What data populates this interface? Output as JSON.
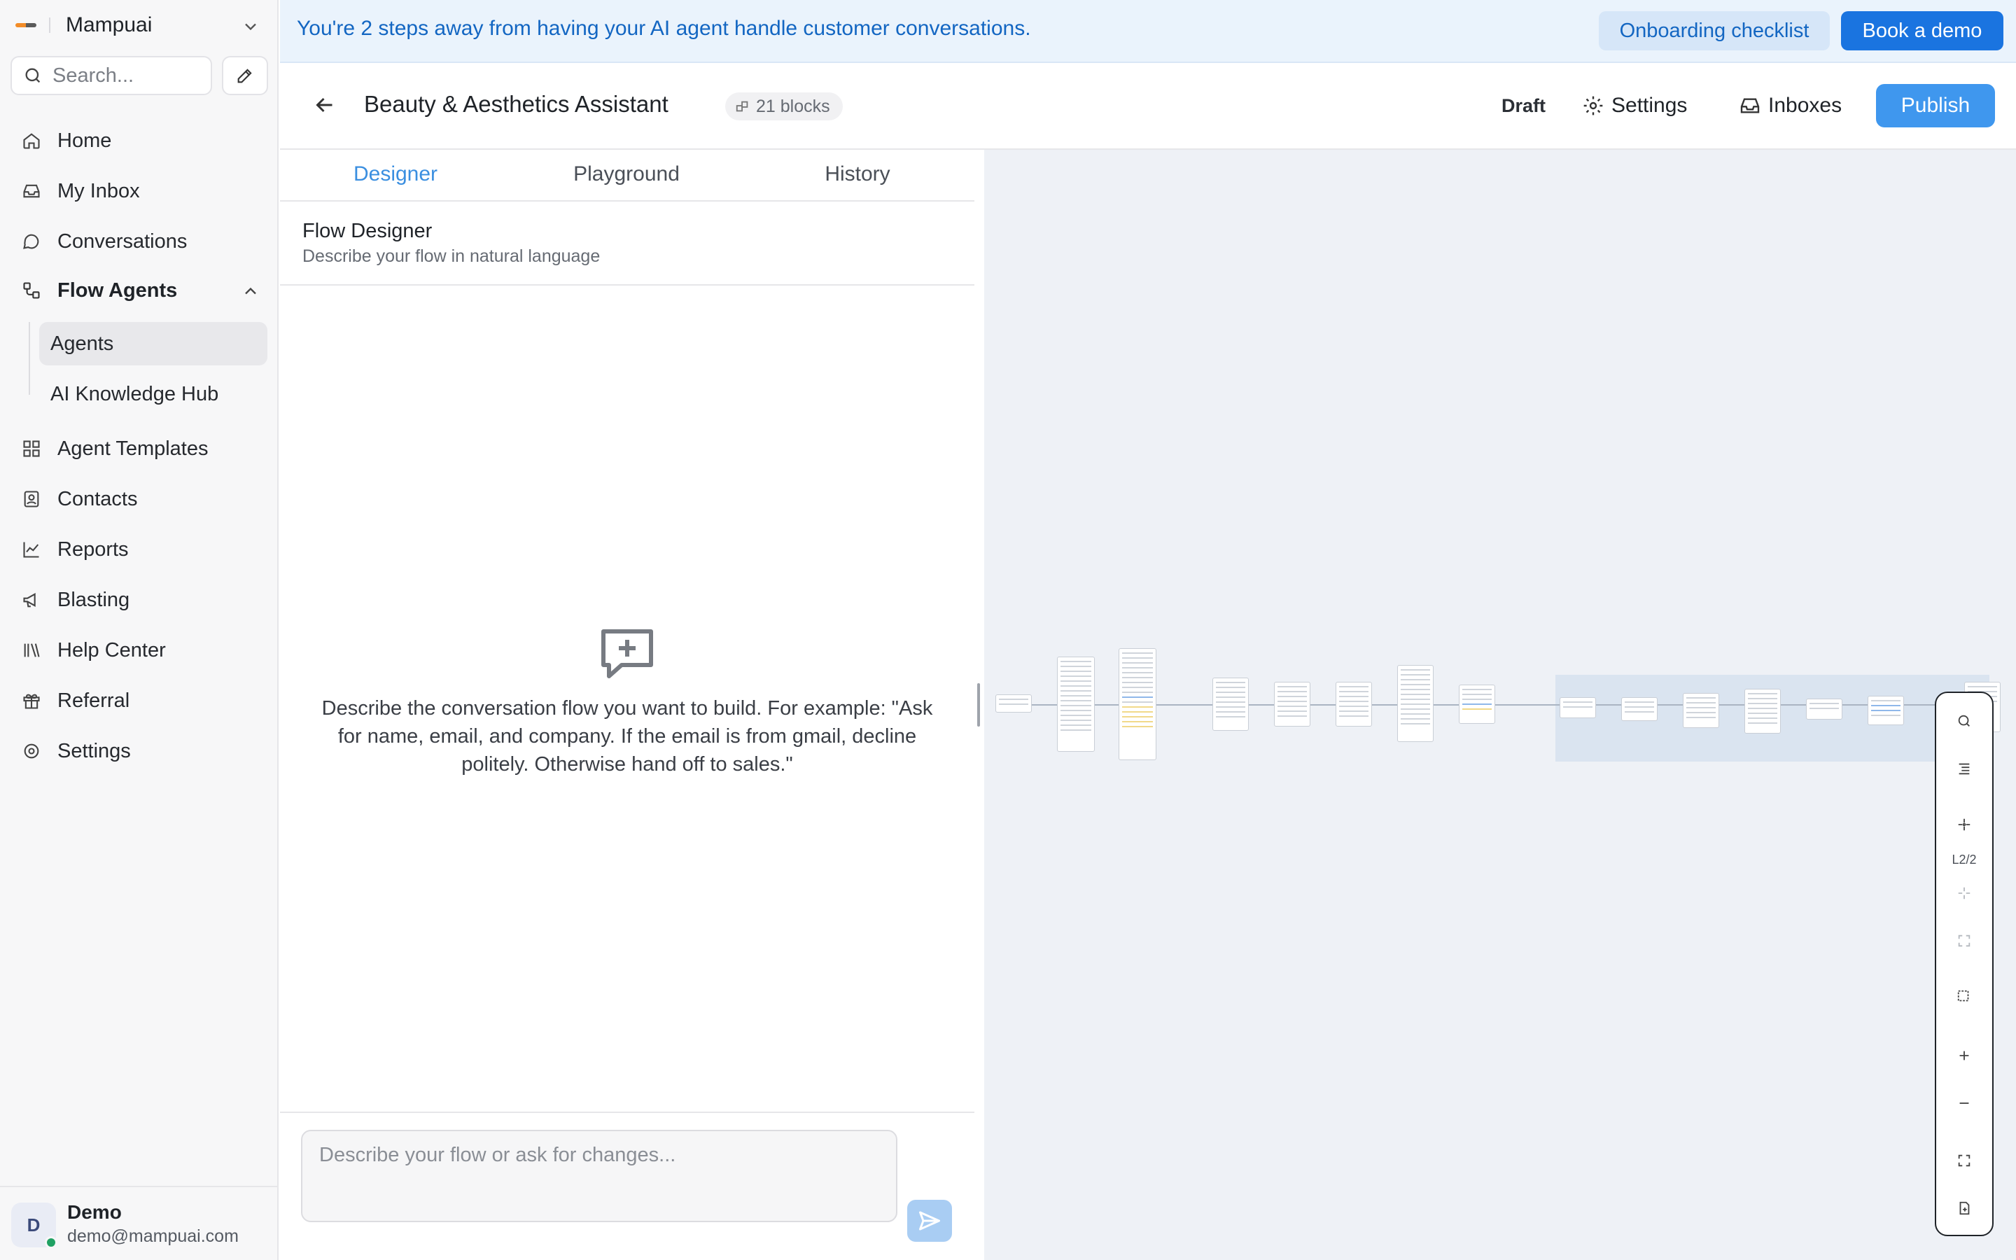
{
  "brand": {
    "name": "Mampuai"
  },
  "search": {
    "placeholder": "Search..."
  },
  "nav": {
    "home": "Home",
    "inbox": "My Inbox",
    "conversations": "Conversations",
    "flow_agents": "Flow Agents",
    "agents": "Agents",
    "knowledge": "AI Knowledge Hub",
    "templates": "Agent Templates",
    "contacts": "Contacts",
    "reports": "Reports",
    "blasting": "Blasting",
    "help": "Help Center",
    "referral": "Referral",
    "settings": "Settings"
  },
  "user": {
    "initial": "D",
    "name": "Demo",
    "email": "demo@mampuai.com"
  },
  "banner": {
    "message": "You're 2 steps away from having your AI agent handle customer conversations.",
    "onboarding": "Onboarding checklist",
    "demo": "Book a demo"
  },
  "header": {
    "title": "Beauty & Aesthetics Assistant",
    "blocks": "21 blocks",
    "status": "Draft",
    "settings": "Settings",
    "inboxes": "Inboxes",
    "publish": "Publish"
  },
  "tabs": {
    "designer": "Designer",
    "playground": "Playground",
    "history": "History"
  },
  "designer": {
    "title": "Flow Designer",
    "subtitle": "Describe your flow in natural language",
    "empty_text": "Describe the conversation flow you want to build. For example: \"Ask for name, email, and company. If the email is from gmail, decline politely. Otherwise hand off to sales.\"",
    "composer_placeholder": "Describe your flow or ask for changes..."
  },
  "canvas": {
    "level": "L2/2"
  },
  "colors": {
    "accent": "#3f97ee",
    "banner_bg": "#eaf3fc",
    "banner_text": "#1366c2",
    "online": "#1fa163"
  }
}
